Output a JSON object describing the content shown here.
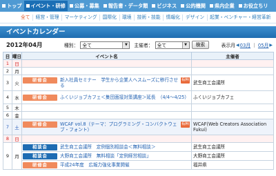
{
  "topnav": [
    {
      "label": "トップ"
    },
    {
      "label": "イベント・研修"
    },
    {
      "label": "公募・募集"
    },
    {
      "label": "報告書・データ類"
    },
    {
      "label": "ビジネス"
    },
    {
      "label": "公的機関"
    },
    {
      "label": "県内企業"
    },
    {
      "label": "お役立ちリ"
    }
  ],
  "subnav": [
    "全て",
    "経営・管理",
    "マーケティング",
    "国際化",
    "環境",
    "技術・技能",
    "情報化",
    "デザイン",
    "起業・ベンチャー・経営革新"
  ],
  "page_title": "イベントカレンダー",
  "toolbar": {
    "month": "2012年04月",
    "type_label": "種別：",
    "type_value": "全て",
    "host_label": "主催者：",
    "host_value": "全て",
    "search_label": "検索",
    "display_label": "表示月",
    "prev_month": "03月",
    "sep": "｜",
    "next_month": "05月"
  },
  "table": {
    "headers": {
      "day": "日",
      "weekday": "曜日",
      "event": "イベント名",
      "host": "主催者"
    },
    "rows": [
      {
        "day": "1",
        "weekday": "日",
        "kind": "sun",
        "events": []
      },
      {
        "day": "2",
        "weekday": "月",
        "kind": "",
        "events": []
      },
      {
        "day": "3",
        "weekday": "火",
        "kind": "",
        "events": [
          {
            "cat": "研修会",
            "color": "orange",
            "title": "新入社員セミナー　学生から企業人へスムーズに移行させる",
            "fee": "有料",
            "host": "武生商工会議所"
          }
        ]
      },
      {
        "day": "4",
        "weekday": "水",
        "kind": "",
        "events": [
          {
            "cat": "研修会",
            "color": "orange",
            "title": "ふくいジョブカフェ＜集団面接対策講座＞延長　（4/4～4/25）",
            "fee": "",
            "host": "ふくいジョブカフェ"
          }
        ]
      },
      {
        "day": "5",
        "weekday": "木",
        "kind": "",
        "events": []
      },
      {
        "day": "6",
        "weekday": "金",
        "kind": "",
        "events": []
      },
      {
        "day": "7",
        "weekday": "土",
        "kind": "sat",
        "events": [
          {
            "cat": "研修会",
            "color": "orange",
            "title": "WCAF vol.8（テーマ：プログラミング・コンバクトウェブ・フォント）",
            "fee": "有料",
            "host": "WCAF(Web Creators Association Fukui)"
          }
        ]
      },
      {
        "day": "8",
        "weekday": "日",
        "kind": "sun",
        "events": []
      },
      {
        "day": "9",
        "weekday": "月",
        "kind": "",
        "events": [
          {
            "cat": "相談会",
            "color": "blue",
            "title": "武生商工会議所　定例個別相談会＜無料相談＞",
            "fee": "",
            "host": "武生商工会議所"
          },
          {
            "cat": "相談会",
            "color": "blue",
            "title": "大野商工会議所　無料相談「定例経営相談」",
            "fee": "",
            "host": "大野商工会議所"
          },
          {
            "cat": "研修会",
            "color": "orange",
            "title": "平成24年度　広報力強化事業開催",
            "fee": "",
            "host": "福井県"
          }
        ]
      }
    ]
  }
}
